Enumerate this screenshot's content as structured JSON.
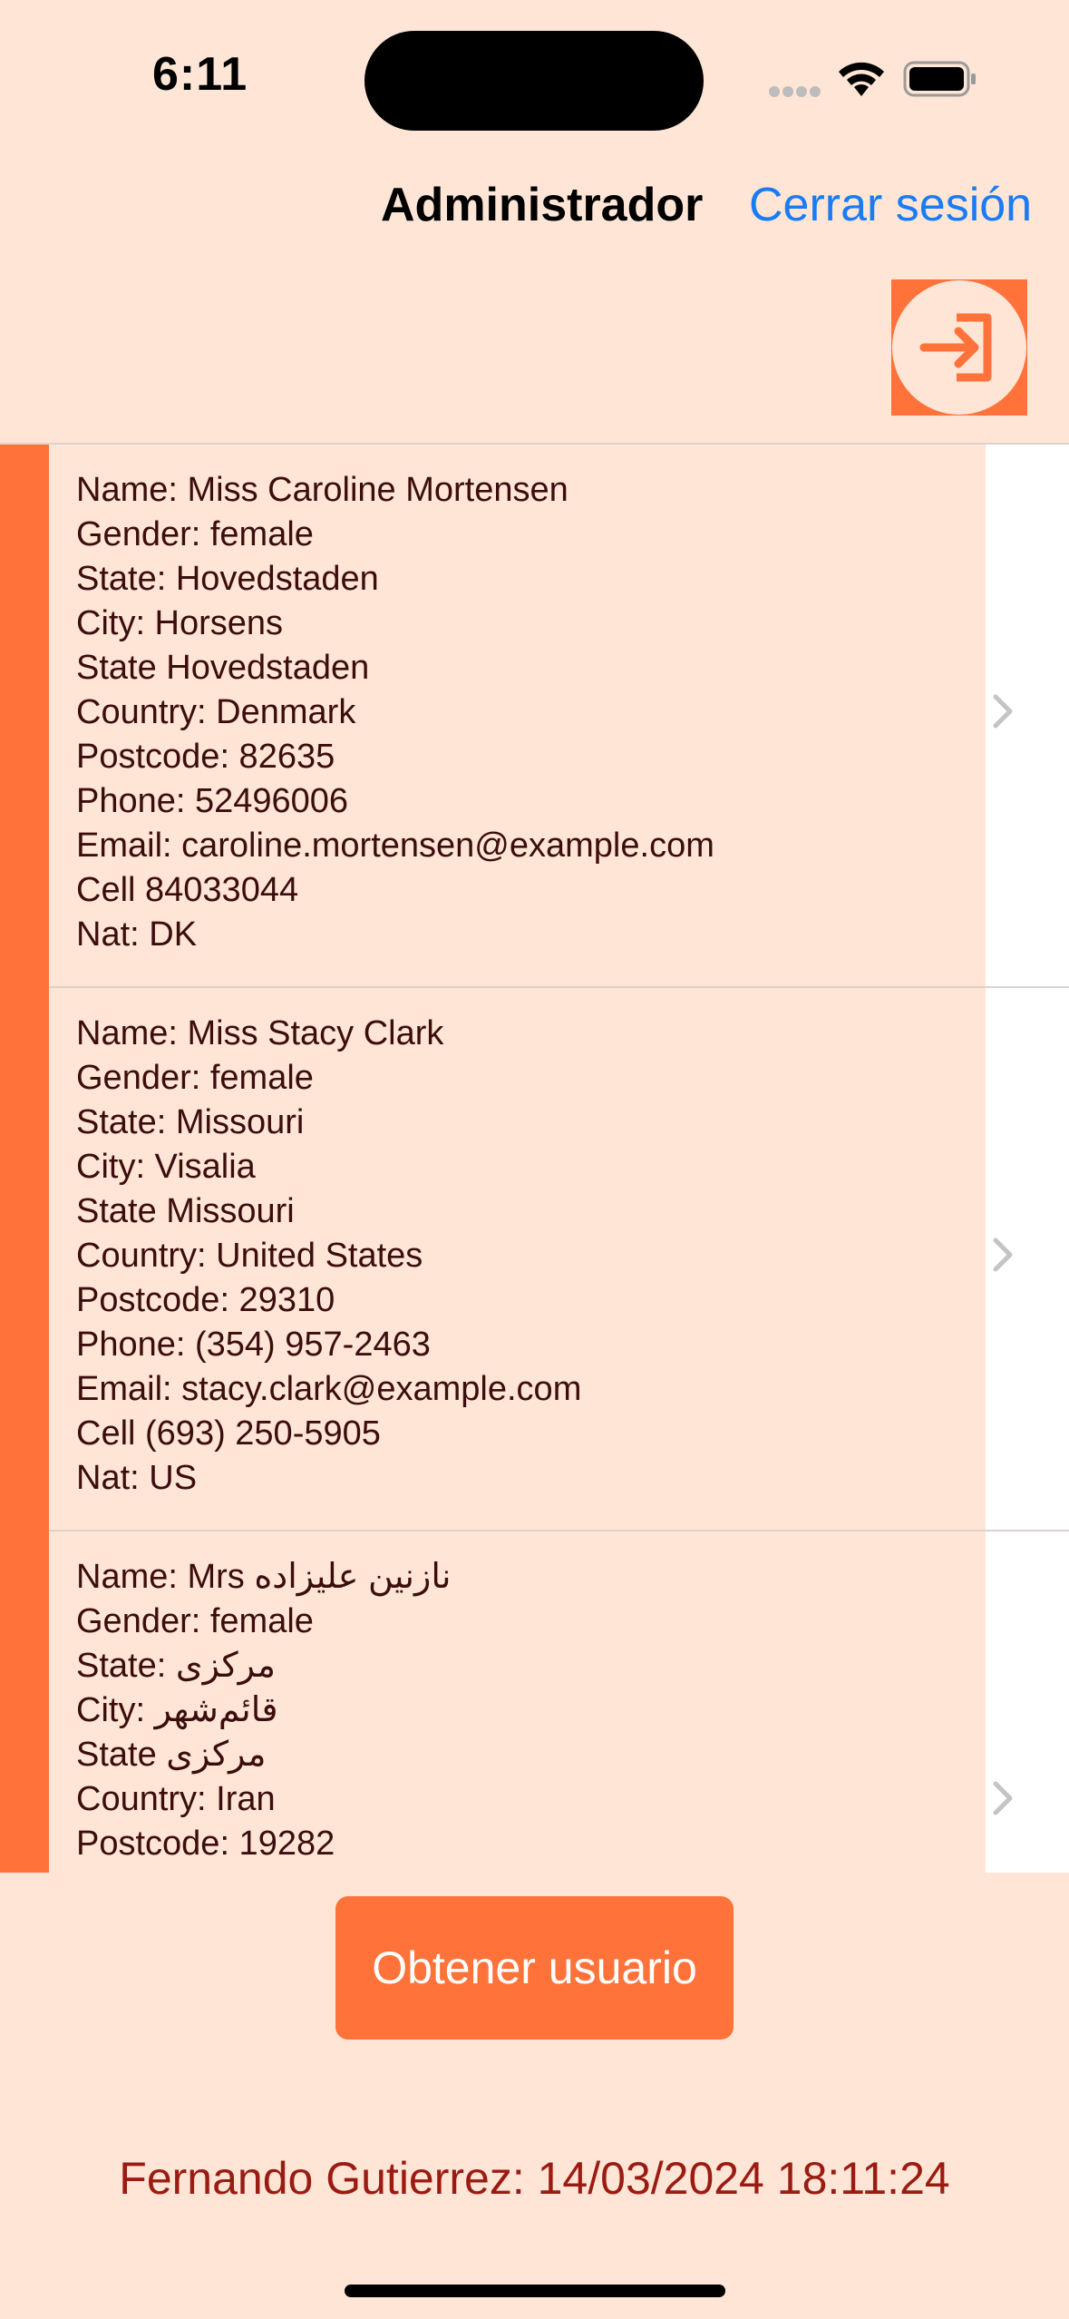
{
  "status_bar": {
    "time": "6:11"
  },
  "nav": {
    "title": "Administrador",
    "logout_label": "Cerrar sesión"
  },
  "icons": {
    "login": "login-arrow-icon",
    "chevron": "chevron-right-icon",
    "wifi": "wifi-icon",
    "battery": "battery-icon",
    "signal": "signal-icon"
  },
  "colors": {
    "accent": "#FF733A",
    "background": "#FEE5D6",
    "link": "#1A7CF5",
    "text": "#3B0D0D",
    "footer_text": "#9B1B12"
  },
  "users": [
    {
      "lines": [
        "Name: Miss Caroline Mortensen",
        "Gender: female",
        "State: Hovedstaden",
        "City: Horsens",
        "State Hovedstaden",
        "Country: Denmark",
        "Postcode: 82635",
        "Phone: 52496006",
        "Email: caroline.mortensen@example.com",
        "Cell 84033044",
        "Nat: DK"
      ]
    },
    {
      "lines": [
        "Name: Miss Stacy Clark",
        "Gender: female",
        "State: Missouri",
        "City: Visalia",
        "State Missouri",
        "Country: United States",
        "Postcode: 29310",
        "Phone: (354) 957-2463",
        "Email: stacy.clark@example.com",
        "Cell (693) 250-5905",
        "Nat: US"
      ]
    },
    {
      "lines": [
        "Name: Mrs نازنین علیزاده",
        "Gender: female",
        "State: مرکزی",
        "City: قائم‌شهر",
        "State مرکزی",
        "Country: Iran",
        "Postcode: 19282"
      ]
    }
  ],
  "actions": {
    "get_user_label": "Obtener usuario"
  },
  "footer": {
    "text": "Fernando Gutierrez: 14/03/2024 18:11:24"
  }
}
